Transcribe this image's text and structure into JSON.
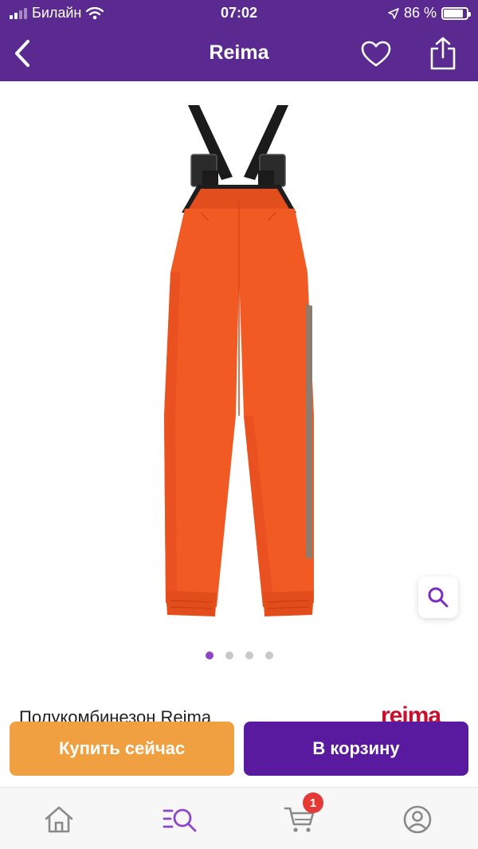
{
  "status_bar": {
    "carrier": "Билайн",
    "time": "07:02",
    "battery_text": "86 %",
    "battery_level": 0.86
  },
  "nav": {
    "title": "Reima",
    "back_icon": "chevron-left-icon",
    "favorite_icon": "heart-icon",
    "share_icon": "share-icon"
  },
  "gallery": {
    "image_count": 4,
    "active_index": 0,
    "zoom_icon": "search-icon"
  },
  "product": {
    "title": "Полукомбинезон Reima",
    "brand_logo": "reima"
  },
  "actions": {
    "buy_now": "Купить сейчас",
    "add_to_cart": "В корзину"
  },
  "tab_bar": {
    "items": [
      {
        "icon": "home-icon"
      },
      {
        "icon": "catalog-search-icon",
        "active": true
      },
      {
        "icon": "cart-icon",
        "badge": "1"
      },
      {
        "icon": "profile-icon"
      }
    ]
  },
  "colors": {
    "header": "#5b2a91",
    "accent": "#8e44c6",
    "buy_now": "#f0a040",
    "add_to_cart": "#5a1aa0",
    "badge": "#e53935",
    "product": "#f25a23"
  }
}
